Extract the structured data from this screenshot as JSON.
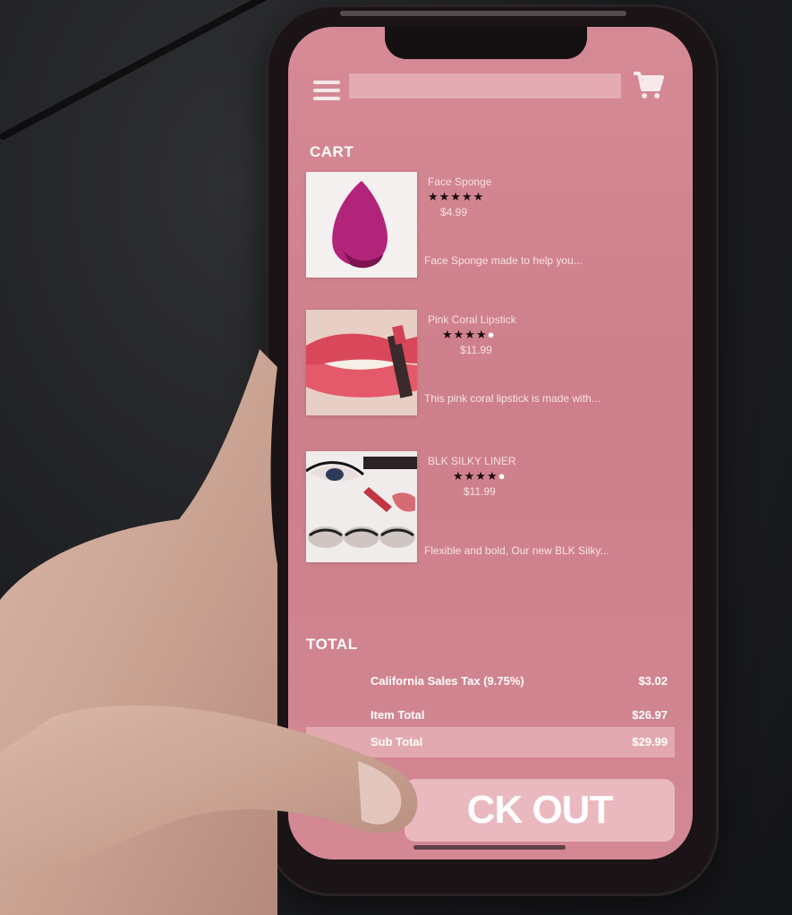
{
  "colors": {
    "screen_bg": "#d68a95",
    "accent": "#eab9c0",
    "star_filled": "#1a0c10",
    "star_empty": "#ffffff"
  },
  "header": {
    "search_placeholder": "",
    "menu_icon": "hamburger-menu-icon",
    "cart_icon": "shopping-cart-icon"
  },
  "cart": {
    "title": "CART",
    "items": [
      {
        "name": "Face Sponge",
        "stars_filled": "★★★★★",
        "stars_empty": "",
        "rating": 5,
        "price": "$4.99",
        "description": "Face Sponge made to help you..."
      },
      {
        "name": "Pink Coral Lipstick",
        "stars_filled": "★★★★",
        "stars_empty": "●",
        "rating": 4,
        "price": "$11.99",
        "description": "This pink coral lipstick is made with..."
      },
      {
        "name": "BLK SILKY LINER",
        "stars_filled": "★★★★",
        "stars_empty": "●",
        "rating": 4,
        "price": "$11.99",
        "description": "Flexible and bold, Our new BLK Silky..."
      }
    ]
  },
  "total": {
    "title": "TOTAL",
    "rows": [
      {
        "label": "California Sales Tax (9.75%)",
        "value": "$3.02"
      },
      {
        "label": "Item Total",
        "value": "$26.97"
      },
      {
        "label": "Sub Total",
        "value": "$29.99"
      }
    ]
  },
  "checkout": {
    "label": "CK OUT"
  }
}
